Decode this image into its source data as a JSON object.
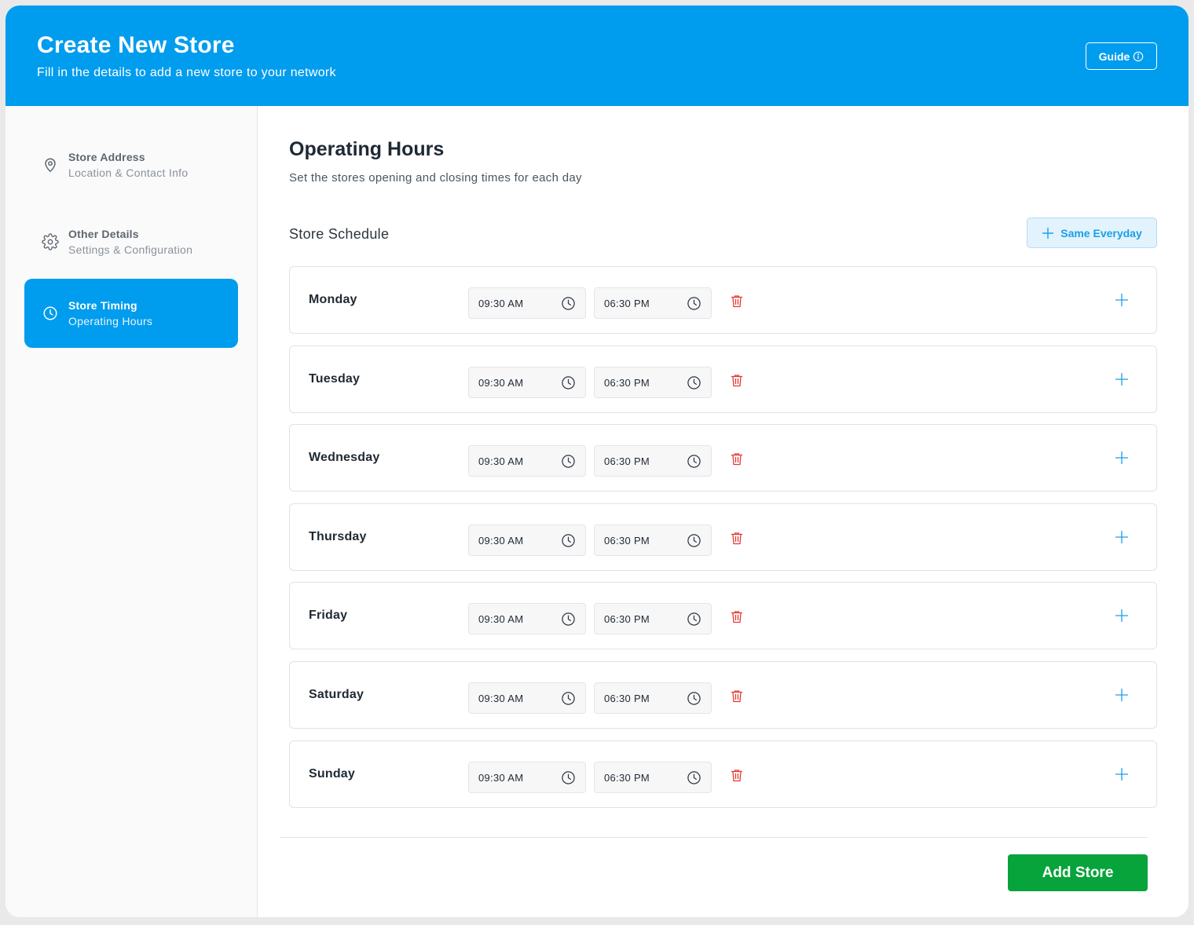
{
  "header": {
    "title": "Create New Store",
    "subtitle": "Fill in the details to add a new store to your network",
    "guide_label": "Guide",
    "guide_icon": "info-circle-icon",
    "background_color": "#009cee"
  },
  "sidebar": {
    "items": [
      {
        "label": "Store Address",
        "sublabel": "Location & Contact Info",
        "icon": "map-pin-icon",
        "active": false
      },
      {
        "label": "Other Details",
        "sublabel": "Settings & Configuration",
        "icon": "gear-icon",
        "active": false
      },
      {
        "label": "Store Timing",
        "sublabel": "Operating Hours",
        "icon": "clock-icon",
        "active": true
      }
    ]
  },
  "main": {
    "title": "Operating Hours",
    "subtitle": "Set the stores opening and closing times for each day",
    "schedule_title": "Store Schedule",
    "same_everyday_label": "Same Everyday",
    "days": [
      {
        "name": "Monday",
        "open": "09:30 AM",
        "close": "06:30 PM"
      },
      {
        "name": "Tuesday",
        "open": "09:30 AM",
        "close": "06:30 PM"
      },
      {
        "name": "Wednesday",
        "open": "09:30 AM",
        "close": "06:30 PM"
      },
      {
        "name": "Thursday",
        "open": "09:30 AM",
        "close": "06:30 PM"
      },
      {
        "name": "Friday",
        "open": "09:30 AM",
        "close": "06:30 PM"
      },
      {
        "name": "Saturday",
        "open": "09:30 AM",
        "close": "06:30 PM"
      },
      {
        "name": "Sunday",
        "open": "09:30 AM",
        "close": "06:30 PM"
      }
    ],
    "add_store_label": "Add Store",
    "colors": {
      "accent": "#009cee",
      "delete": "#e53935",
      "add_button": "#07a33b"
    }
  }
}
